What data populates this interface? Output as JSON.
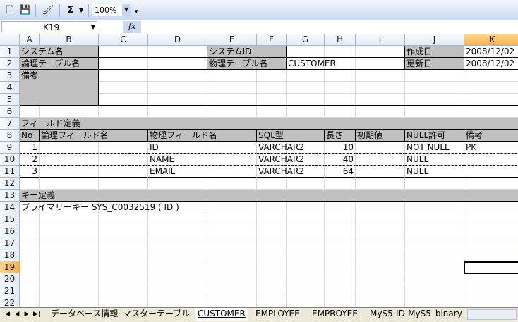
{
  "toolbar": {
    "zoom": "100%",
    "sigma": "Σ"
  },
  "formula_bar": {
    "name_box": "K19",
    "fx": "fx"
  },
  "columns": [
    "A",
    "B",
    "C",
    "D",
    "E",
    "F",
    "G",
    "H",
    "I",
    "J",
    "K"
  ],
  "rows": [
    "1",
    "2",
    "3",
    "4",
    "5",
    "6",
    "7",
    "8",
    "9",
    "10",
    "11",
    "12",
    "13",
    "14",
    "15",
    "16",
    "17",
    "18",
    "19",
    "20",
    "21",
    "22"
  ],
  "sheet": {
    "system_name_label": "システム名",
    "system_name_value": "",
    "system_id_label": "システムID",
    "system_id_value": "",
    "created_label": "作成日",
    "created_value": "2008/12/02",
    "logical_table_label": "論理テーブル名",
    "logical_table_value": "",
    "physical_table_label": "物理テーブル名",
    "physical_table_value": "CUSTOMER",
    "updated_label": "更新日",
    "updated_value": "2008/12/02",
    "remarks_label": "備考",
    "field_def_title": "フィールド定義",
    "field_headers": {
      "no": "No",
      "logical": "論理フィールド名",
      "physical": "物理フィールド名",
      "sql": "SQL型",
      "len": "長さ",
      "init": "初期値",
      "null": "NULL許可",
      "remarks": "備考"
    },
    "fields": [
      {
        "no": "1",
        "logical": "",
        "physical": "ID",
        "sql": "VARCHAR2",
        "len": "10",
        "init": "",
        "null": "NOT NULL",
        "remarks": "PK"
      },
      {
        "no": "2",
        "logical": "",
        "physical": "NAME",
        "sql": "VARCHAR2",
        "len": "40",
        "init": "",
        "null": "NULL",
        "remarks": ""
      },
      {
        "no": "3",
        "logical": "",
        "physical": "EMAIL",
        "sql": "VARCHAR2",
        "len": "64",
        "init": "",
        "null": "NULL",
        "remarks": ""
      }
    ],
    "key_def_title": "キー定義",
    "primary_key": "プライマリーキー SYS_C0032519 ( ID )"
  },
  "tabs": [
    "データベース情報",
    "マスターテーブル",
    "CUSTOMER",
    "EMPLOYEE",
    "EMPROYEE",
    "MyS5-ID-MyS5_binary"
  ],
  "active_tab": "CUSTOMER"
}
